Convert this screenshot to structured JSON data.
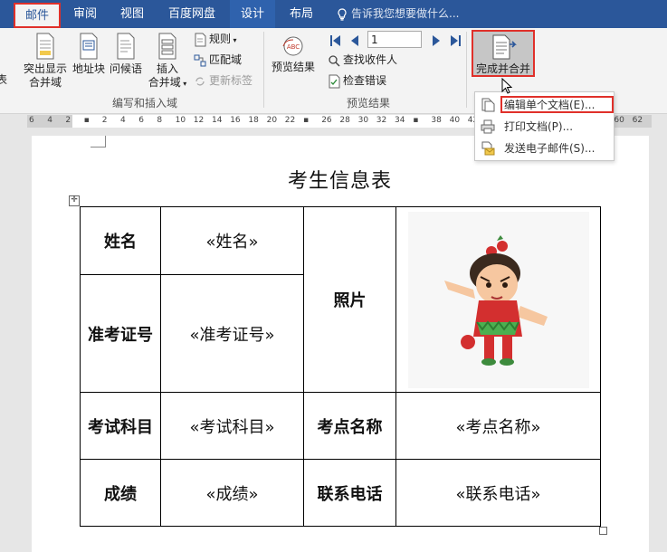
{
  "tabs": [
    {
      "label": "邮件",
      "active": true
    },
    {
      "label": "审阅"
    },
    {
      "label": "视图"
    },
    {
      "label": "百度网盘"
    },
    {
      "label": "设计"
    },
    {
      "label": "布局"
    }
  ],
  "tell_me": "告诉我您想要做什么...",
  "ribbon": {
    "edge_label": "表",
    "highlight_fields": "突出显示\n合并域",
    "address_block": "地址块",
    "greeting": "问候语",
    "insert_field": "插入\n合并域",
    "rules": "规则",
    "match_fields": "匹配域",
    "update_labels": "更新标签",
    "group_insert": "编写和插入域",
    "preview_results": "预览结果",
    "record_number": "1",
    "find_recipient": "查找收件人",
    "check_errors": "检查错误",
    "group_preview": "预览结果",
    "finish_merge": "完成并合并"
  },
  "ruler_ticks": [
    "6",
    "4",
    "2",
    "",
    "2",
    "4",
    "6",
    "8",
    "10",
    "12",
    "14",
    "16",
    "18",
    "20",
    "22",
    "",
    "26",
    "28",
    "30",
    "32",
    "34",
    "",
    "38",
    "40",
    "42",
    "44",
    "46",
    "48",
    "50",
    "",
    "",
    "",
    "60",
    "62"
  ],
  "dropdown": {
    "items": [
      {
        "label": "编辑单个文档(E)..."
      },
      {
        "label": "打印文档(P)..."
      },
      {
        "label": "发送电子邮件(S)..."
      }
    ]
  },
  "document": {
    "title": "考生信息表",
    "name_label": "姓名",
    "name_field": "«姓名»",
    "photo_label": "照片",
    "id_label": "准考证号",
    "id_field": "«准考证号»",
    "subject_label": "考试科目",
    "subject_field": "«考试科目»",
    "site_label": "考点名称",
    "site_field": "«考点名称»",
    "score_label": "成绩",
    "score_field": "«成绩»",
    "phone_label": "联系电话",
    "phone_field": "«联系电话»"
  },
  "colors": {
    "tab_bar": "#2b579a",
    "highlight_box": "#e0302a"
  }
}
